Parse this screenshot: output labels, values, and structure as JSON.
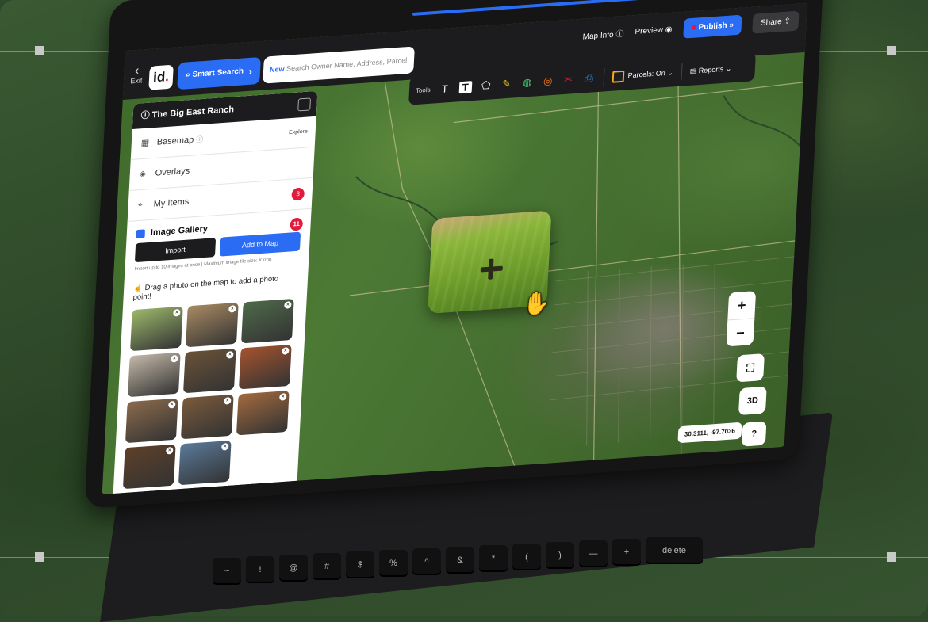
{
  "topbar": {
    "exit_label": "Exit",
    "logo_text": "id",
    "logo_dot": ".",
    "smart_search_label": "Smart Search",
    "search_new_tag": "New",
    "search_placeholder": "Search Owner Name, Address, Parcel Id",
    "map_info_label": "Map Info",
    "preview_label": "Preview",
    "publish_label": "Publish",
    "share_label": "Share"
  },
  "toolbar": {
    "tools_label": "Tools",
    "parcels_label": "Parcels: On",
    "reports_label": "Reports"
  },
  "sidebar": {
    "title": "The Big East Ranch",
    "basemap_label": "Basemap",
    "explore_label": "Explore",
    "overlays_label": "Overlays",
    "my_items_label": "My Items",
    "my_items_count": "3",
    "gallery_title": "Image Gallery",
    "gallery_count": "11",
    "import_label": "Import",
    "add_to_map_label": "Add to Map",
    "gallery_note": "Import up to 10 images at once  |  Maximum image file size: XXmb",
    "drag_hint": "Drag a photo on the map to add a photo point!",
    "thumbnails": [
      {
        "color": "#9cb86a"
      },
      {
        "color": "#a88a62"
      },
      {
        "color": "#4f6a4a"
      },
      {
        "color": "#c4b8a8"
      },
      {
        "color": "#6a5238"
      },
      {
        "color": "#a5532e"
      },
      {
        "color": "#8a6a4c"
      },
      {
        "color": "#7a5a3c"
      },
      {
        "color": "#a26a3e"
      },
      {
        "color": "#5e4028"
      },
      {
        "color": "#5a7a9a"
      }
    ]
  },
  "map": {
    "coords": "30.3111, -97.7036",
    "zoom_in": "+",
    "zoom_out": "−",
    "three_d": "3D",
    "help": "?"
  },
  "keyboard": {
    "delete_label": "delete"
  }
}
